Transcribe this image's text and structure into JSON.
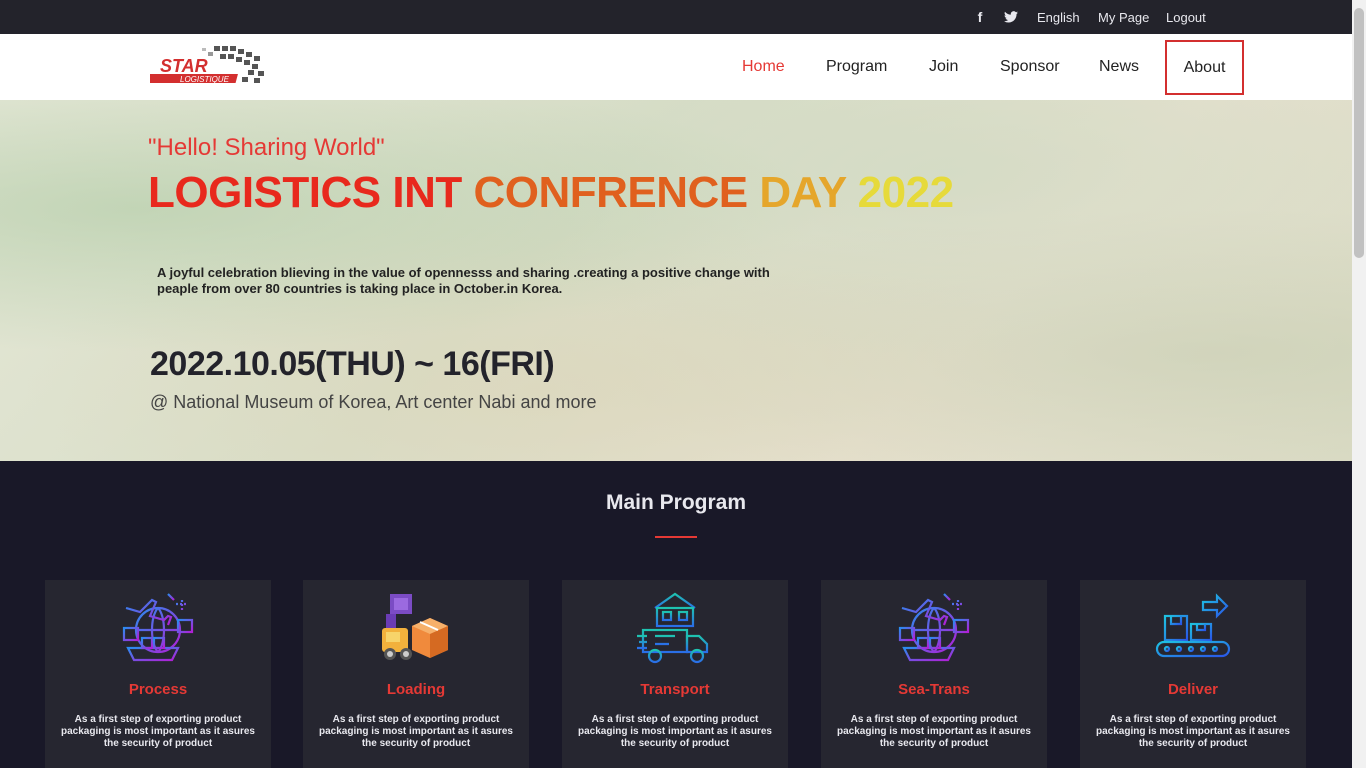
{
  "topbar": {
    "facebook_icon": "facebook-icon",
    "twitter_icon": "twitter-icon",
    "language": "English",
    "mypage": "My Page",
    "logout": "Logout"
  },
  "logo": {
    "text_main": "STAR",
    "text_sub": "LOGISTIQUE"
  },
  "nav": {
    "items": [
      {
        "label": "Home",
        "active": true
      },
      {
        "label": "Program"
      },
      {
        "label": "Join"
      },
      {
        "label": "Sponsor"
      },
      {
        "label": "News"
      },
      {
        "label": "About",
        "focused": true
      }
    ]
  },
  "hero": {
    "hello": "\"Hello! Sharing World\"",
    "headline_parts": [
      "LOGISTICS INT ",
      "CONFRENCE ",
      "DAY ",
      "2022"
    ],
    "description": "A joyful celebration blieving in the value of opennesss and sharing .creating a positive change with peaple from over 80 countries is taking place in October.in Korea.",
    "dates": "2022.10.05(THU) ~ 16(FRI)",
    "venue": "@ National Museum of Korea, Art center Nabi and more"
  },
  "program": {
    "title": "Main Program",
    "cards": [
      {
        "name": "Process",
        "icon": "globe-ship-plane-icon",
        "text": "As a first step of exporting product packaging is most important as it asures the security of product"
      },
      {
        "name": "Loading",
        "icon": "forklift-box-icon",
        "text": "As a first step of exporting product packaging is most important as it asures the security of product"
      },
      {
        "name": "Transport",
        "icon": "warehouse-truck-icon",
        "text": "As a first step of exporting product packaging is most important as it asures the security of product"
      },
      {
        "name": "Sea-Trans",
        "icon": "globe-ship-plane-icon",
        "text": "As a first step of exporting product packaging is most important as it asures the security of product"
      },
      {
        "name": "Deliver",
        "icon": "conveyor-boxes-icon",
        "text": "As a first step of exporting product packaging is most important as it asures the security of product"
      }
    ]
  },
  "colors": {
    "accent_red": "#e53935",
    "topbar_bg": "#23232b",
    "program_bg": "#191828",
    "card_bg": "#262630"
  }
}
